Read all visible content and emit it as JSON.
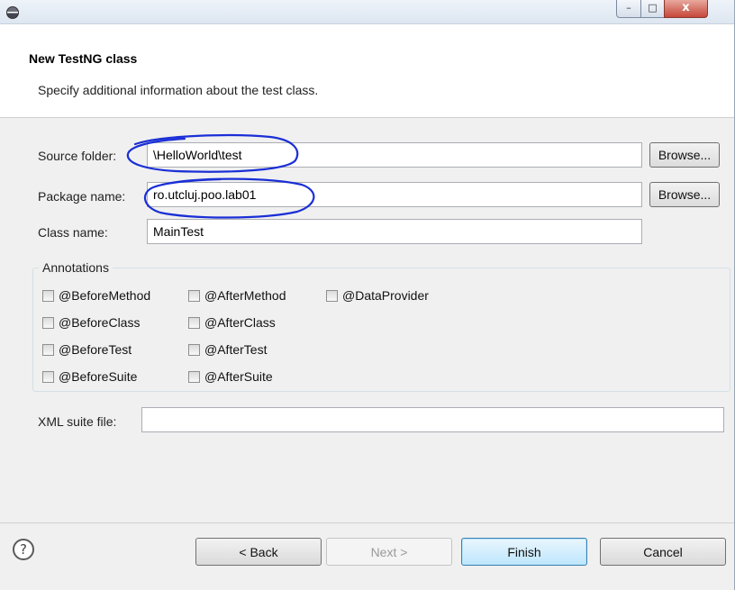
{
  "window": {
    "controls": {
      "minimize": "–",
      "maximize": "□",
      "close": "x"
    }
  },
  "header": {
    "title": "New TestNG class",
    "description": "Specify additional information about the test class."
  },
  "form": {
    "source_folder": {
      "label": "Source folder:",
      "value": "\\HelloWorld\\test",
      "browse_label": "Browse..."
    },
    "package_name": {
      "label": "Package name:",
      "value": "ro.utcluj.poo.lab01",
      "browse_label": "Browse..."
    },
    "class_name": {
      "label": "Class name:",
      "value": "MainTest"
    }
  },
  "annotations": {
    "legend": "Annotations",
    "items": [
      {
        "label": "@BeforeMethod",
        "checked": false
      },
      {
        "label": "@AfterMethod",
        "checked": false
      },
      {
        "label": "@DataProvider",
        "checked": false
      },
      {
        "label": "@BeforeClass",
        "checked": false
      },
      {
        "label": "@AfterClass",
        "checked": false
      },
      {
        "label": "@BeforeTest",
        "checked": false
      },
      {
        "label": "@AfterTest",
        "checked": false
      },
      {
        "label": "@BeforeSuite",
        "checked": false
      },
      {
        "label": "@AfterSuite",
        "checked": false
      }
    ]
  },
  "xml_suite": {
    "label": "XML suite file:",
    "value": ""
  },
  "buttons": {
    "help": "?",
    "back": "< Back",
    "next": "Next >",
    "finish": "Finish",
    "cancel": "Cancel"
  },
  "colors": {
    "annotation_ink": "#1a2fd6",
    "default_button_border": "#3c7fb1"
  },
  "icons": {
    "app": "eclipse-icon",
    "help": "help-icon"
  }
}
